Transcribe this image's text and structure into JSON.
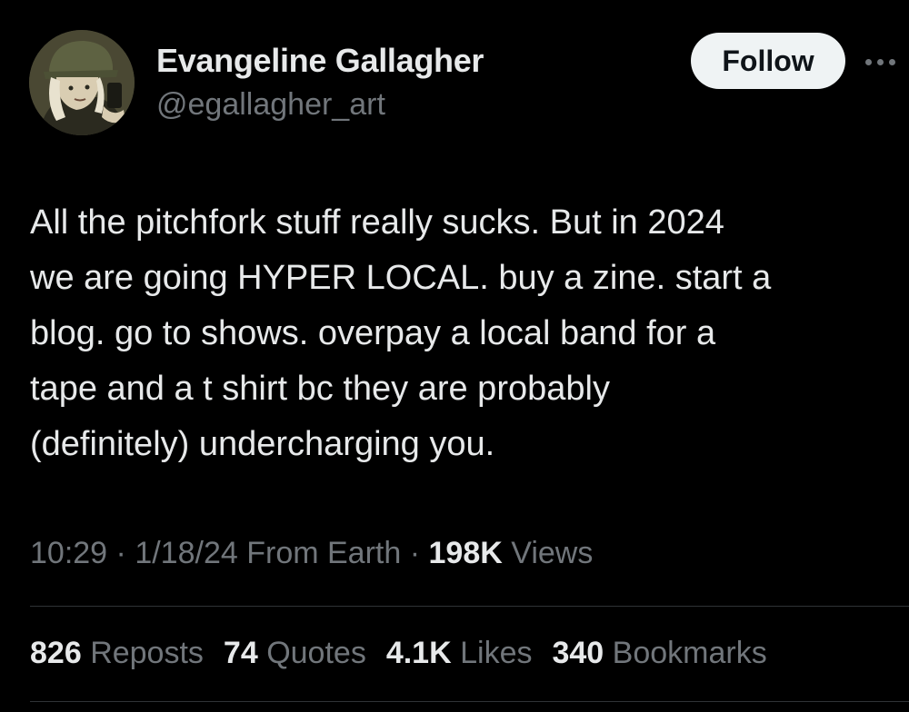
{
  "author": {
    "display_name": "Evangeline Gallagher",
    "handle": "@egallagher_art",
    "avatar_icon": "illustrated-portrait-avatar"
  },
  "actions": {
    "follow_label": "Follow",
    "more_icon": "more-horizontal-icon"
  },
  "tweet": {
    "lines": [
      "All the pitchfork stuff really sucks. But in 2024",
      "we are going HYPER LOCAL. buy a zine. start a",
      "blog. go to shows. overpay a local band for a",
      "tape and a t shirt bc they are probably",
      "(definitely) undercharging you."
    ]
  },
  "meta": {
    "time": "10:29",
    "date": "1/18/24",
    "source": "From Earth",
    "separator": "·",
    "views_count": "198K",
    "views_label": "Views"
  },
  "stats": [
    {
      "count": "826",
      "label": "Reposts"
    },
    {
      "count": "74",
      "label": "Quotes"
    },
    {
      "count": "4.1K",
      "label": "Likes"
    },
    {
      "count": "340",
      "label": "Bookmarks"
    }
  ],
  "colors": {
    "background": "#000000",
    "primary_text": "#e7e9ea",
    "secondary_text": "#71767b",
    "divider": "#2f3336",
    "follow_button_bg": "#eff3f4",
    "follow_button_text": "#0f1419"
  }
}
